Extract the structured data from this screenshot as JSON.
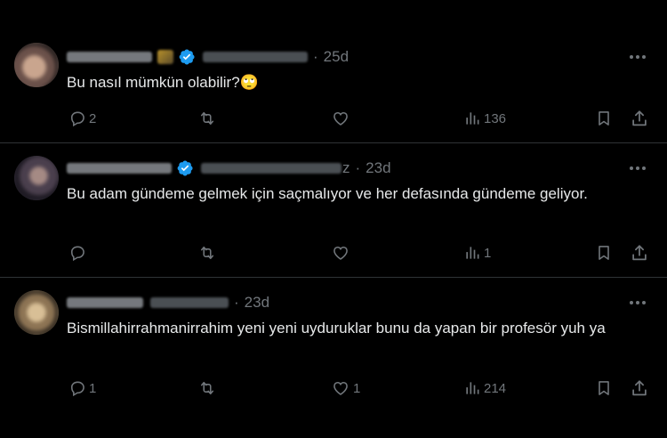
{
  "replies": [
    {
      "time": "25d",
      "text": "Bu nasıl mümkün olabilir?",
      "text_emoji": "🙄",
      "replies_count": "2",
      "retweets_count": "",
      "likes_count": "",
      "views_count": "136"
    },
    {
      "handle_tail": "z",
      "time": "23d",
      "text": "Bu adam gündeme gelmek için saçmalıyor ve her defasında gündeme geliyor.",
      "replies_count": "",
      "retweets_count": "",
      "likes_count": "",
      "views_count": "1"
    },
    {
      "time": "23d",
      "text": "Bismillahirrahmanirrahim yeni yeni uydurukl​ar bunu da yapan bir profesör yuh ya",
      "replies_count": "1",
      "retweets_count": "",
      "likes_count": "1",
      "views_count": "214"
    }
  ],
  "icons": {
    "reply": "reply-icon",
    "retweet": "retweet-icon",
    "like": "heart-icon",
    "views": "views-icon",
    "bookmark": "bookmark-icon",
    "share": "share-icon",
    "more": "more-icon",
    "verified": "verified-badge-icon"
  },
  "colors": {
    "background": "#000000",
    "text": "#e7e9ea",
    "muted": "#71767b",
    "verified": "#1d9bf0",
    "divider": "#2f3336"
  }
}
